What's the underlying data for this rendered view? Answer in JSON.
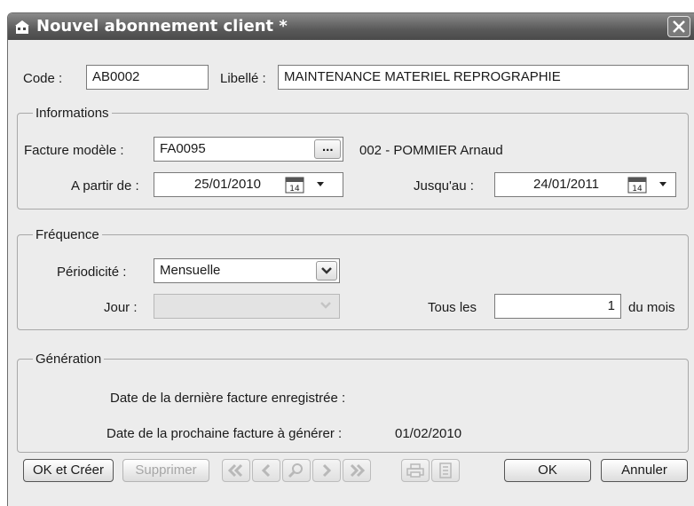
{
  "window": {
    "title": "Nouvel abonnement client *"
  },
  "header": {
    "code_label": "Code :",
    "code_value": "AB0002",
    "libelle_label": "Libellé :",
    "libelle_value": "MAINTENANCE MATERIEL REPROGRAPHIE"
  },
  "informations": {
    "title": "Informations",
    "facture_label": "Facture modèle :",
    "facture_value": "FA0095",
    "browse_label": "...",
    "client_text": "002 - POMMIER Arnaud",
    "apartir_label": "A partir de :",
    "apartir_value": "25/01/2010",
    "jusquau_label": "Jusqu'au :",
    "jusquau_value": "24/01/2011",
    "calendar_day": "14"
  },
  "frequence": {
    "title": "Fréquence",
    "periodicite_label": "Périodicité :",
    "periodicite_value": "Mensuelle",
    "jour_label": "Jour :",
    "jour_value": "",
    "tous_les_label": "Tous les",
    "tous_les_value": "1",
    "du_mois_label": "du mois"
  },
  "generation": {
    "title": "Génération",
    "derniere_label": "Date de la dernière facture enregistrée :",
    "derniere_value": "",
    "prochaine_label": "Date de la prochaine facture à générer :",
    "prochaine_value": "01/02/2010"
  },
  "buttons": {
    "ok_creer": "OK et Créer",
    "supprimer": "Supprimer",
    "ok": "OK",
    "annuler": "Annuler"
  }
}
